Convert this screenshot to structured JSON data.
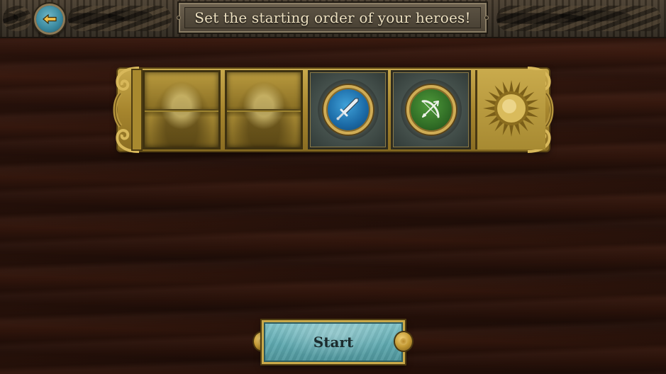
{
  "header": {
    "back_icon": "arrow-left-icon",
    "title": "Set the starting order of your heroes!"
  },
  "hero_order": {
    "slots": [
      {
        "position": 1,
        "state": "empty"
      },
      {
        "position": 2,
        "state": "empty"
      },
      {
        "position": 3,
        "state": "hero",
        "icon": "sword-icon",
        "color": "#1b6aa6"
      },
      {
        "position": 4,
        "state": "hero",
        "icon": "bow-icon",
        "color": "#2f6b25"
      }
    ],
    "end_icon": "sun-icon"
  },
  "footer": {
    "start_label": "Start"
  },
  "colors": {
    "accent_gold": "#c9a94a",
    "button_teal": "#5fa9b0",
    "background_wood": "#2c130b"
  }
}
